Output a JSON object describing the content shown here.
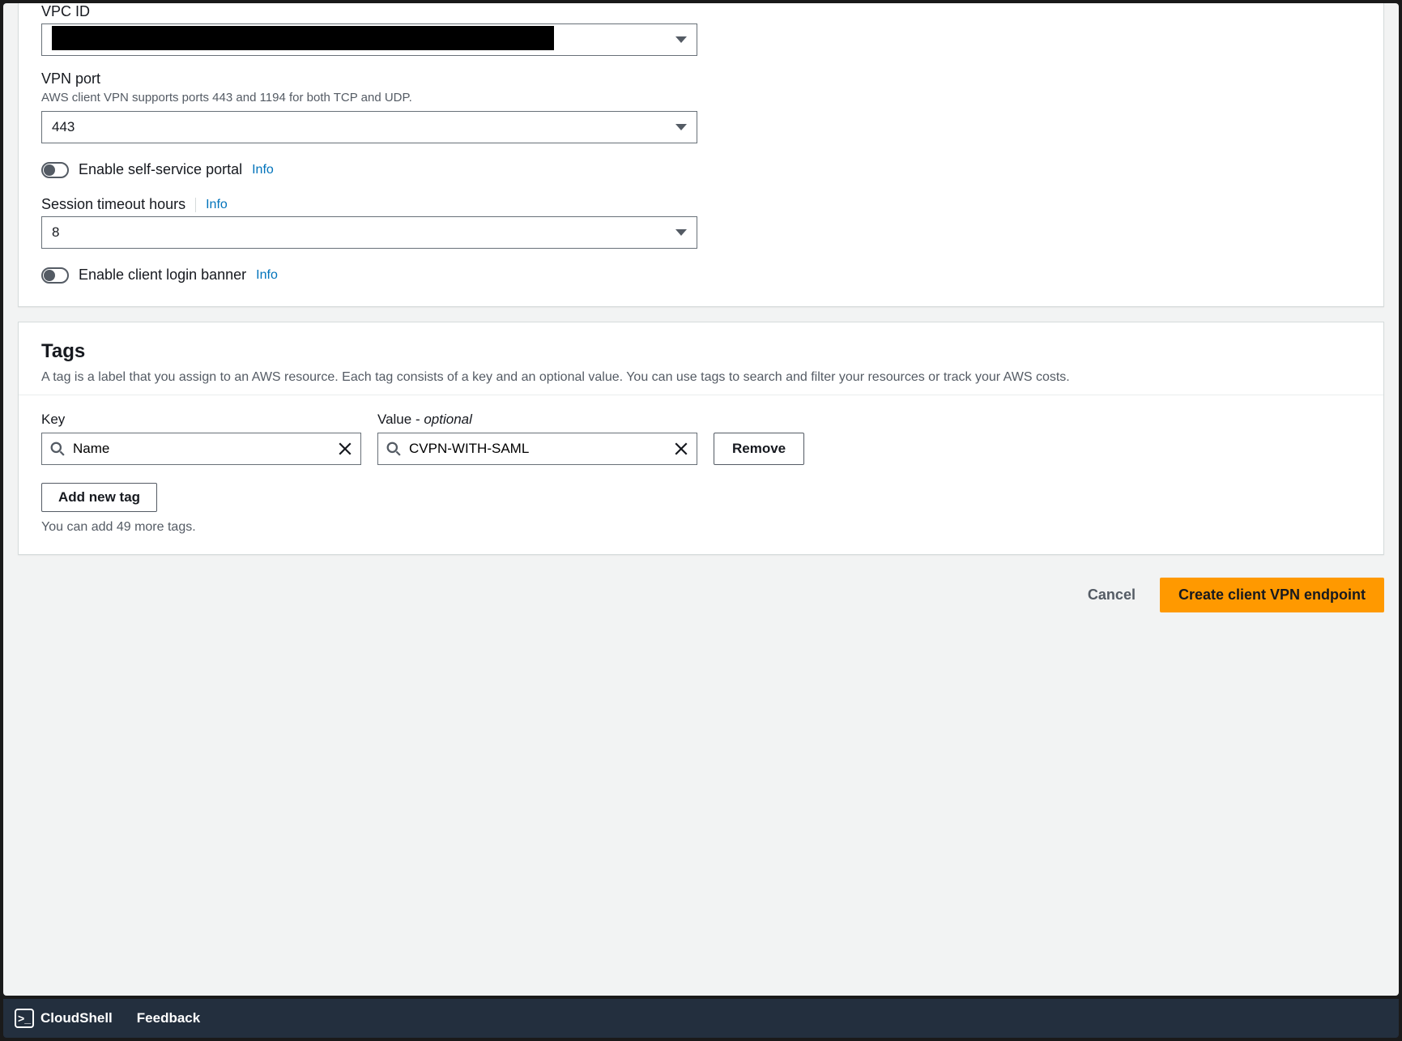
{
  "vpc": {
    "label": "VPC ID",
    "value_redacted": true
  },
  "vpn_port": {
    "label": "VPN port",
    "hint": "AWS client VPN supports ports 443 and 1194 for both TCP and UDP.",
    "value": "443"
  },
  "self_service": {
    "label": "Enable self-service portal",
    "info": "Info"
  },
  "session_timeout": {
    "label": "Session timeout hours",
    "info": "Info",
    "value": "8"
  },
  "login_banner": {
    "label": "Enable client login banner",
    "info": "Info"
  },
  "tags": {
    "title": "Tags",
    "description": "A tag is a label that you assign to an AWS resource. Each tag consists of a key and an optional value. You can use tags to search and filter your resources or track your AWS costs.",
    "key_label": "Key",
    "value_label": "Value - ",
    "value_optional": "optional",
    "key_value": "Name",
    "val_value": "CVPN-WITH-SAML",
    "remove": "Remove",
    "add": "Add new tag",
    "remaining": "You can add 49 more tags."
  },
  "actions": {
    "cancel": "Cancel",
    "submit": "Create client VPN endpoint"
  },
  "footer": {
    "cloudshell": "CloudShell",
    "feedback": "Feedback"
  }
}
